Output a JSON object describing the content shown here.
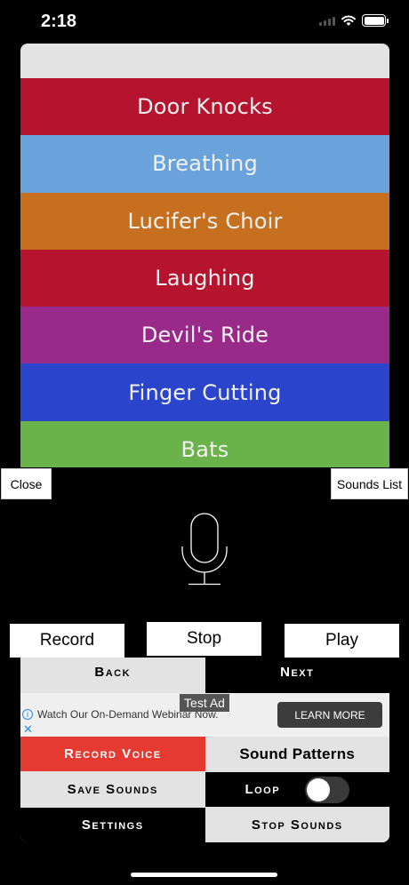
{
  "status_bar": {
    "time": "2:18"
  },
  "sound_list": {
    "items": [
      {
        "label": "Door Knocks",
        "color": "#b5132e"
      },
      {
        "label": "Breathing",
        "color": "#6aa2dc"
      },
      {
        "label": "Lucifer's Choir",
        "color": "#c6701f"
      },
      {
        "label": "Laughing",
        "color": "#b5132e"
      },
      {
        "label": "Devil's Ride",
        "color": "#992a89"
      },
      {
        "label": "Finger Cutting",
        "color": "#2a44cc"
      },
      {
        "label": "Bats",
        "color": "#6ab24a"
      }
    ]
  },
  "buttons": {
    "close": "Close",
    "sounds_list": "Sounds List",
    "record": "Record",
    "stop": "Stop",
    "play": "Play"
  },
  "nav": {
    "back": "Back",
    "next": "Next"
  },
  "ad": {
    "badge": "Test Ad",
    "text": "Watch Our On-Demand Webinar Now.",
    "cta": "LEARN MORE"
  },
  "options": {
    "record_voice": "Record Voice",
    "sound_patterns": "Sound Patterns",
    "save_sounds": "Save Sounds",
    "loop": "Loop",
    "loop_on": false,
    "settings": "Settings",
    "stop_sounds": "Stop Sounds"
  },
  "icons": {
    "mic": "microphone-icon",
    "info": "info-icon",
    "close_ad": "close-icon"
  }
}
